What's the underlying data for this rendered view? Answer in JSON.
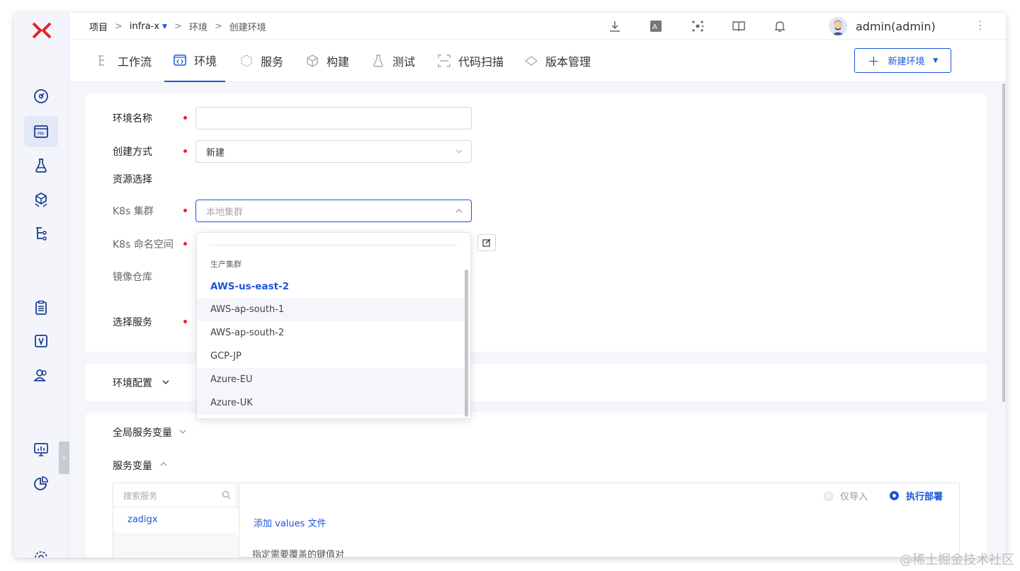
{
  "breadcrumb": {
    "root": "项目",
    "project": "infra-x",
    "env": "环境",
    "current": "创建环境"
  },
  "user": {
    "name": "admin(admin)"
  },
  "tabs": [
    {
      "label": "工作流",
      "icon": "workflow-icon"
    },
    {
      "label": "环境",
      "icon": "environment-icon",
      "active": true
    },
    {
      "label": "服务",
      "icon": "service-icon"
    },
    {
      "label": "构建",
      "icon": "build-icon"
    },
    {
      "label": "测试",
      "icon": "test-icon"
    },
    {
      "label": "代码扫描",
      "icon": "scan-icon"
    },
    {
      "label": "版本管理",
      "icon": "version-icon"
    }
  ],
  "new_env_button": "新建环境",
  "form": {
    "env_name_label": "环境名称",
    "env_name_value": "",
    "create_mode_label": "创建方式",
    "create_mode_value": "新建",
    "resource_label": "资源选择",
    "k8s_cluster_label": "K8s 集群",
    "k8s_cluster_placeholder": "本地集群",
    "k8s_namespace_label": "K8s 命名空间",
    "registry_label": "镜像仓库",
    "select_service_label": "选择服务"
  },
  "dropdown": {
    "group": "生产集群",
    "items": [
      "AWS-us-east-2",
      "AWS-ap-south-1",
      "AWS-ap-south-2",
      "GCP-JP",
      "Azure-EU",
      "Azure-UK"
    ],
    "selected": "AWS-us-east-2"
  },
  "env_config_label": "环境配置",
  "global_vars_label": "全局服务变量",
  "service_vars_label": "服务变量",
  "service_search_placeholder": "搜索服务",
  "services": [
    "zadigx"
  ],
  "import_only_label": "仅导入",
  "deploy_label": "执行部署",
  "add_values_label": "添加 values 文件",
  "override_hint": "指定需要覆盖的键值对",
  "watermark": "@稀土掘金技术社区",
  "colors": {
    "accent": "#1a56db",
    "required": "#e5252a",
    "logo": "#e5252a"
  }
}
